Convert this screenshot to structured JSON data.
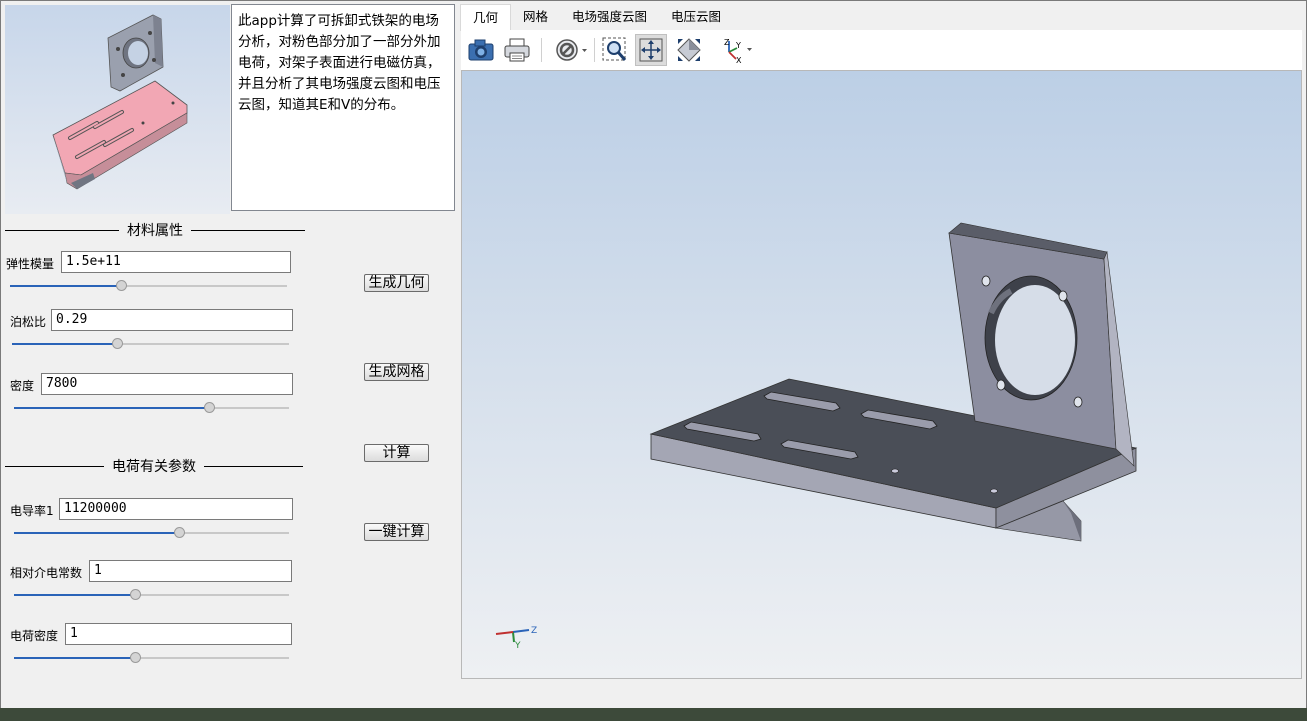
{
  "description": "此app计算了可拆卸式铁架的电场分析，对粉色部分加了一部分外加电荷，对架子表面进行电磁仿真，并且分析了其电场强度云图和电压云图，知道其E和V的分布。",
  "material_section": {
    "title": "材料属性",
    "elastic_modulus": {
      "label": "弹性模量",
      "value": "1.5e+11",
      "slider": 0.4
    },
    "poisson_ratio": {
      "label": "泊松比",
      "value": "0.29",
      "slider": 0.38
    },
    "density": {
      "label": "密度",
      "value": "7800",
      "slider": 0.71
    }
  },
  "charge_section": {
    "title": "电荷有关参数",
    "conductivity": {
      "label": "电导率1",
      "value": "11200000",
      "slider": 0.6
    },
    "permittivity": {
      "label": "相对介电常数",
      "value": "1",
      "slider": 0.44
    },
    "charge_density": {
      "label": "电荷密度",
      "value": "1",
      "slider": 0.44
    }
  },
  "buttons": {
    "generate_geometry": "生成几何",
    "generate_mesh": "生成网格",
    "compute": "计算",
    "one_click_compute": "一键计算"
  },
  "tabs": [
    "几何",
    "网格",
    "电场强度云图",
    "电压云图"
  ],
  "active_tab": 0,
  "axis_labels": {
    "z": "Z",
    "y": "Y",
    "x": "X"
  },
  "toolbar_icons": [
    "camera-icon",
    "print-icon",
    "visibility-icon",
    "zoom-box-icon",
    "zoom-extents-icon",
    "zoom-fit-icon",
    "axis-orientation-icon"
  ],
  "colors": {
    "accent": "#2a63b8",
    "model_top": "#4a4e57",
    "model_side": "#9496a4",
    "pink_part": "#f2a7b4"
  }
}
